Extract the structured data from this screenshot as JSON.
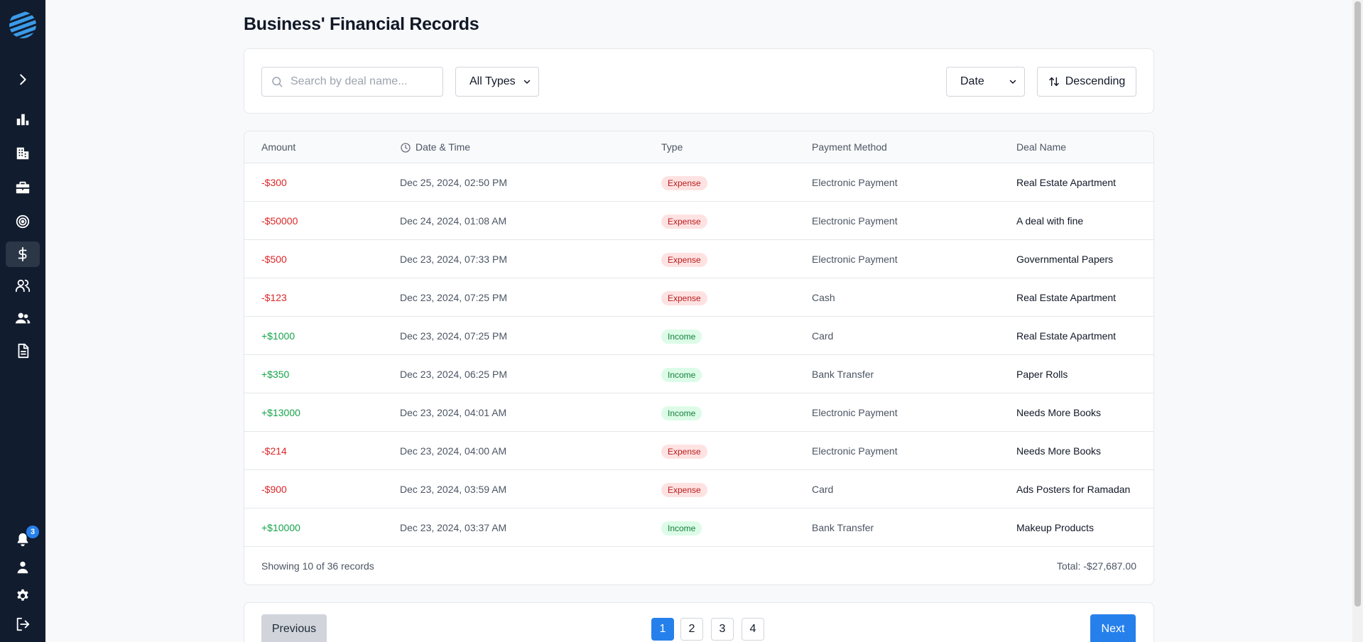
{
  "page": {
    "title": "Business' Financial Records"
  },
  "sidebar": {
    "notification_count": "3",
    "items": [
      {
        "name": "expand",
        "icon": "chevron-right-icon"
      },
      {
        "name": "analytics",
        "icon": "bar-chart-icon"
      },
      {
        "name": "companies",
        "icon": "building-icon"
      },
      {
        "name": "deals",
        "icon": "briefcase-icon"
      },
      {
        "name": "targets",
        "icon": "target-icon"
      },
      {
        "name": "finance",
        "icon": "dollar-icon",
        "active": true
      },
      {
        "name": "users",
        "icon": "users-icon"
      },
      {
        "name": "team",
        "icon": "team-icon"
      },
      {
        "name": "documents",
        "icon": "document-icon"
      }
    ]
  },
  "filters": {
    "search_placeholder": "Search by deal name...",
    "type_selected": "All Types",
    "sort_field_selected": "Date",
    "sort_order_label": "Descending"
  },
  "table": {
    "headers": {
      "amount": "Amount",
      "date": "Date & Time",
      "type": "Type",
      "method": "Payment Method",
      "deal": "Deal Name"
    },
    "rows": [
      {
        "amount": "-$300",
        "sign": "neg",
        "date": "Dec 25, 2024, 02:50 PM",
        "type": "Expense",
        "method": "Electronic Payment",
        "deal": "Real Estate Apartment"
      },
      {
        "amount": "-$50000",
        "sign": "neg",
        "date": "Dec 24, 2024, 01:08 AM",
        "type": "Expense",
        "method": "Electronic Payment",
        "deal": "A deal with fine"
      },
      {
        "amount": "-$500",
        "sign": "neg",
        "date": "Dec 23, 2024, 07:33 PM",
        "type": "Expense",
        "method": "Electronic Payment",
        "deal": "Governmental Papers"
      },
      {
        "amount": "-$123",
        "sign": "neg",
        "date": "Dec 23, 2024, 07:25 PM",
        "type": "Expense",
        "method": "Cash",
        "deal": "Real Estate Apartment"
      },
      {
        "amount": "+$1000",
        "sign": "pos",
        "date": "Dec 23, 2024, 07:25 PM",
        "type": "Income",
        "method": "Card",
        "deal": "Real Estate Apartment"
      },
      {
        "amount": "+$350",
        "sign": "pos",
        "date": "Dec 23, 2024, 06:25 PM",
        "type": "Income",
        "method": "Bank Transfer",
        "deal": "Paper Rolls"
      },
      {
        "amount": "+$13000",
        "sign": "pos",
        "date": "Dec 23, 2024, 04:01 AM",
        "type": "Income",
        "method": "Electronic Payment",
        "deal": "Needs More Books"
      },
      {
        "amount": "-$214",
        "sign": "neg",
        "date": "Dec 23, 2024, 04:00 AM",
        "type": "Expense",
        "method": "Electronic Payment",
        "deal": "Needs More Books"
      },
      {
        "amount": "-$900",
        "sign": "neg",
        "date": "Dec 23, 2024, 03:59 AM",
        "type": "Expense",
        "method": "Card",
        "deal": "Ads Posters for Ramadan"
      },
      {
        "amount": "+$10000",
        "sign": "pos",
        "date": "Dec 23, 2024, 03:37 AM",
        "type": "Income",
        "method": "Bank Transfer",
        "deal": "Makeup Products"
      }
    ],
    "showing": "Showing 10 of 36 records",
    "total": "Total: -$27,687.00"
  },
  "pagination": {
    "previous_label": "Previous",
    "next_label": "Next",
    "pages": [
      "1",
      "2",
      "3",
      "4"
    ],
    "current_page": "1"
  },
  "colors": {
    "sidebar_bg": "#111c2e",
    "accent": "#2680eb",
    "expense": "#dc2626",
    "income": "#16a34a"
  }
}
